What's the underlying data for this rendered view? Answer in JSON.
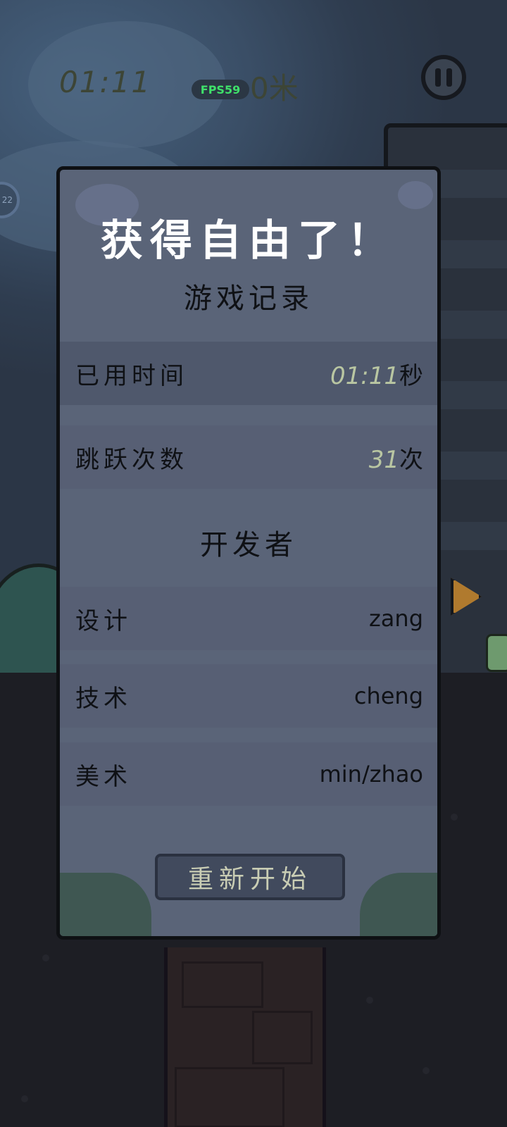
{
  "hud": {
    "time": "01:11",
    "distance": "0米",
    "fps": "FPS59",
    "side_badge": "22"
  },
  "panel": {
    "title": "获得自由了！",
    "record_section": "游戏记录",
    "time_row": {
      "label": "已用时间",
      "value": "01:11",
      "unit": "秒"
    },
    "jump_row": {
      "label": "跳跃次数",
      "value": "31",
      "unit": "次"
    },
    "dev_section": "开发者",
    "developers": [
      {
        "role": "设计",
        "name": "zang"
      },
      {
        "role": "技术",
        "name": "cheng"
      },
      {
        "role": "美术",
        "name": "min/zhao"
      }
    ],
    "restart_label": "重新开始"
  },
  "colors": {
    "panel_bg": "#5a6478",
    "fps_text": "#3fe06a",
    "stat_value": "#b9c6a2"
  }
}
